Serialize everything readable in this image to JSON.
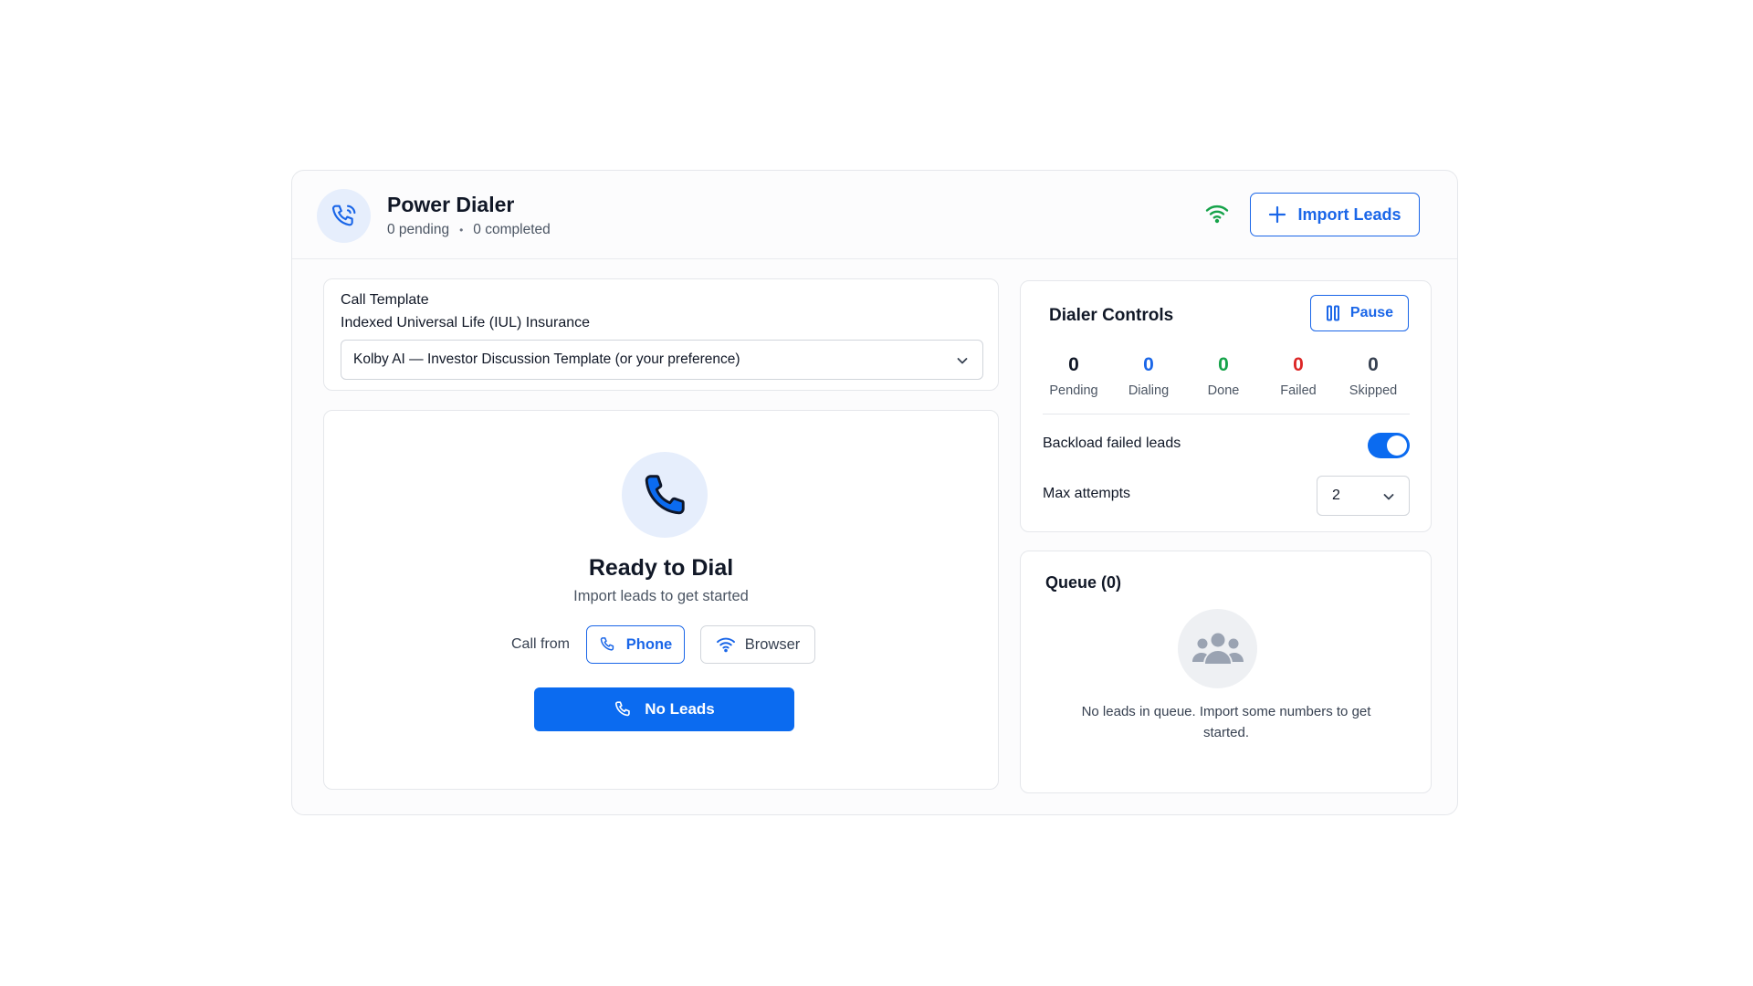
{
  "header": {
    "title": "Power Dialer",
    "pending_text": "0 pending",
    "separator": "•",
    "completed_text": "0 completed",
    "import_button": "Import Leads",
    "icons": [
      "phone-ringing-icon",
      "wifi-icon",
      "plus-icon"
    ]
  },
  "template": {
    "label": "Call Template",
    "product": "Indexed Universal Life (IUL) Insurance",
    "selected": "Kolby AI — Investor Discussion Template (or your preference)"
  },
  "ready": {
    "title": "Ready to Dial",
    "subtitle": "Import leads to get started",
    "call_from_label": "Call from",
    "options": [
      {
        "label": "Phone",
        "selected": true
      },
      {
        "label": "Browser",
        "selected": false
      }
    ],
    "dial_button": "No Leads"
  },
  "controls": {
    "title": "Dialer Controls",
    "pause_button": "Pause",
    "stats": [
      {
        "value": "0",
        "label": "Pending",
        "color": "#111827"
      },
      {
        "value": "0",
        "label": "Dialing",
        "color": "#1a66e8"
      },
      {
        "value": "0",
        "label": "Done",
        "color": "#16a34a"
      },
      {
        "value": "0",
        "label": "Failed",
        "color": "#dc2626"
      },
      {
        "value": "0",
        "label": "Skipped",
        "color": "#374151"
      }
    ],
    "backlog_label": "Backload failed leads",
    "backlog_enabled": true,
    "max_attempts_label": "Max attempts",
    "max_attempts_value": "2"
  },
  "queue": {
    "title": "Queue (0)",
    "empty_message": "No leads in queue. Import some numbers to get started."
  },
  "colors": {
    "accent": "#1a66e8",
    "primary_button": "#0b6bf0",
    "online": "#16a34a"
  }
}
